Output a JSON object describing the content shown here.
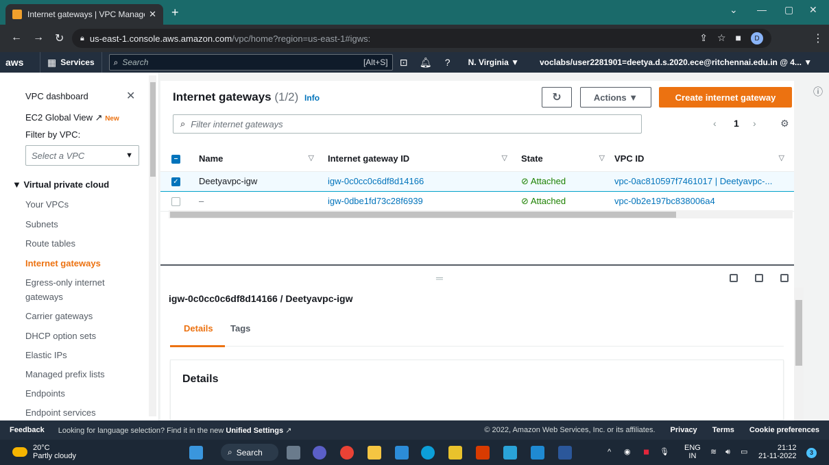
{
  "browser": {
    "tab_title": "Internet gateways | VPC Manager",
    "url_host": "us-east-1.console.aws.amazon.com",
    "url_path": "/vpc/home?region=us-east-1#igws:",
    "profile_initial": "D"
  },
  "aws_nav": {
    "logo": "aws",
    "services_label": "Services",
    "search_placeholder": "Search",
    "search_shortcut": "[Alt+S]",
    "region": "N. Virginia ▼",
    "account": "voclabs/user2281901=deetya.d.s.2020.ece@ritchennai.edu.in @ 4... ▼"
  },
  "sidebar": {
    "dashboard": "VPC dashboard",
    "ec2_global": "EC2 Global View",
    "new_badge": "New",
    "filter_label": "Filter by VPC:",
    "select_placeholder": "Select a VPC",
    "section": "▼ Virtual private cloud",
    "items": [
      "Your VPCs",
      "Subnets",
      "Route tables",
      "Internet gateways",
      "Egress-only internet",
      "gateways",
      "Carrier gateways",
      "DHCP option sets",
      "Elastic IPs",
      "Managed prefix lists",
      "Endpoints",
      "Endpoint services"
    ]
  },
  "main": {
    "title": "Internet gateways",
    "count": "(1/2)",
    "info": "Info",
    "refresh_icon": "↻",
    "actions_label": "Actions ▼",
    "create_label": "Create internet gateway",
    "filter_placeholder": "Filter internet gateways",
    "page_prev": "‹",
    "page_num": "1",
    "page_next": "›",
    "columns": [
      "Name",
      "Internet gateway ID",
      "State",
      "VPC ID"
    ],
    "rows": [
      {
        "name": "Deetyavpc-igw",
        "id": "igw-0c0cc0c6df8d14166",
        "state": "Attached",
        "vpc": "vpc-0ac810597f7461017 | Deetyavpc-..."
      },
      {
        "name": "–",
        "id": "igw-0dbe1fd73c28f6939",
        "state": "Attached",
        "vpc": "vpc-0b2e197bc838006a4"
      }
    ]
  },
  "detail": {
    "title": "igw-0c0cc0c6df8d14166 / Deetyavpc-igw",
    "tabs": [
      "Details",
      "Tags"
    ],
    "card_title": "Details"
  },
  "footer": {
    "feedback": "Feedback",
    "lang_text": "Looking for language selection? Find it in the new",
    "unified": "Unified Settings",
    "copyright": "© 2022, Amazon Web Services, Inc. or its affiliates.",
    "privacy": "Privacy",
    "terms": "Terms",
    "cookies": "Cookie preferences"
  },
  "taskbar": {
    "temp": "20°C",
    "weather": "Partly cloudy",
    "search": "Search",
    "lang1": "ENG",
    "lang2": "IN",
    "time": "21:12",
    "date": "21-11-2022",
    "notifications": "3"
  }
}
